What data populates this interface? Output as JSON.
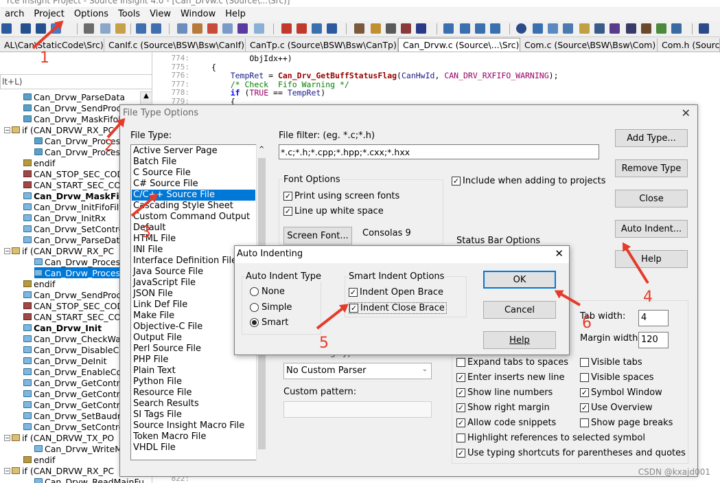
{
  "window": {
    "title": "rce Insight Project - Source Insight 4.0 - [Can_Drvw.c (Source\\...\\Src)]"
  },
  "menu": [
    "arch",
    "Project",
    "Options",
    "Tools",
    "View",
    "Window",
    "Help"
  ],
  "tabs": [
    "AL\\Can\\StaticCode\\Src)",
    "CanIf.c (Source\\BSW\\Bsw\\CanIf)",
    "CanTp.c (Source\\BSW\\Bsw\\CanTp)",
    "Can_Drvw.c (Source\\...\\Src)",
    "Com.c (Source\\BSW\\Bsw\\Com)",
    "Com.h (Source"
  ],
  "symbol_search": "lt+L)",
  "symbols": [
    {
      "label": "Can_Drvw_ParseData",
      "icon": "fn"
    },
    {
      "label": "Can_Drvw_SendProce",
      "icon": "fn"
    },
    {
      "label": "Can_Drvw_MaskFifoF",
      "icon": "fn"
    },
    {
      "label": "if (CAN_DRVW_RX_PC",
      "icon": "cond",
      "toggle": "-"
    },
    {
      "label": "Can_Drvw_Process",
      "icon": "fn",
      "indent": 1
    },
    {
      "label": "Can_Drvw_Process",
      "icon": "fn",
      "indent": 1
    },
    {
      "label": "endif",
      "icon": "endif"
    },
    {
      "label": "CAN_STOP_SEC_CODE",
      "icon": "macro"
    },
    {
      "label": "CAN_START_SEC_COD",
      "icon": "macro"
    },
    {
      "label": "Can_Drvw_MaskFifol",
      "icon": "fnlink",
      "bold": true
    },
    {
      "label": "Can_Drvw_InitFifoFilt",
      "icon": "fnlink"
    },
    {
      "label": "Can_Drvw_InitRx",
      "icon": "fnlink"
    },
    {
      "label": "Can_Drvw_SetContro",
      "icon": "fnlink"
    },
    {
      "label": "Can_Drvw_ParseData",
      "icon": "fnlink"
    },
    {
      "label": "if (CAN_DRVW_RX_PC",
      "icon": "cond",
      "toggle": "-"
    },
    {
      "label": "Can_Drvw_Process",
      "icon": "fnlink",
      "indent": 1
    },
    {
      "label": "Can_Drvw_Process",
      "icon": "fnlink",
      "indent": 1,
      "selected": true
    },
    {
      "label": "endif",
      "icon": "endif"
    },
    {
      "label": "Can_Drvw_SendProce",
      "icon": "fnlink"
    },
    {
      "label": "CAN_STOP_SEC_CODE",
      "icon": "macro"
    },
    {
      "label": "CAN_START_SEC_COD",
      "icon": "macro"
    },
    {
      "label": "Can_Drvw_Init",
      "icon": "fnlink",
      "bold": true
    },
    {
      "label": "Can_Drvw_CheckWak",
      "icon": "fnlink"
    },
    {
      "label": "Can_Drvw_DisableCo",
      "icon": "fnlink"
    },
    {
      "label": "Can_Drvw_DeInit",
      "icon": "fnlink"
    },
    {
      "label": "Can_Drvw_EnableCon",
      "icon": "fnlink"
    },
    {
      "label": "Can_Drvw_GetContro",
      "icon": "fnlink"
    },
    {
      "label": "Can_Drvw_GetContro",
      "icon": "fnlink"
    },
    {
      "label": "Can_Drvw_GetContro",
      "icon": "fnlink"
    },
    {
      "label": "Can_Drvw_SetBaudrat",
      "icon": "fnlink"
    },
    {
      "label": "Can_Drvw_SetContro",
      "icon": "fnlink"
    },
    {
      "label": "if (CAN_DRVW_TX_PO",
      "icon": "cond",
      "toggle": "-"
    },
    {
      "label": "Can_Drvw_WriteMa",
      "icon": "fnlink",
      "indent": 1
    },
    {
      "label": "endif",
      "icon": "endif"
    },
    {
      "label": "if (CAN_DRVW_RX_PC",
      "icon": "cond",
      "toggle": "-"
    },
    {
      "label": "Can_Drvw_ReadMainFu",
      "icon": "fnlink",
      "indent": 1
    }
  ],
  "code": [
    {
      "num": "774:",
      "text": "        ObjIdx++)"
    },
    {
      "num": "775:",
      "text": "{"
    },
    {
      "num": "776:",
      "text": "    TempRet = Can_Drv_GetBuffStatusFlag(CanHwId, CAN_DRV_RXFIFO_WARNING);"
    },
    {
      "num": "777:",
      "text": "    /* Check  Fifo Warning */"
    },
    {
      "num": "778:",
      "text": "    if (TRUE == TempRet)"
    },
    {
      "num": "779:",
      "text": "    {"
    }
  ],
  "code_tail": {
    "num": "822:",
    "text": ""
  },
  "file_type_dialog": {
    "title": "File Type Options",
    "file_type_label": "File Type:",
    "file_types": [
      "Active Server Page",
      "Batch File",
      "C Source File",
      "C# Source File",
      "C/C++ Source File",
      "Cascading Style Sheet",
      "Custom Command Output",
      "Default",
      "HTML File",
      "INI File",
      "Interface Definition File",
      "Java Source File",
      "JavaScript File",
      "JSON File",
      "Link Def File",
      "Make File",
      "Objective-C File",
      "Output File",
      "Perl Source File",
      "PHP File",
      "Plain Text",
      "Python File",
      "Resource File",
      "Search Results",
      "SI Tags File",
      "Source Insight Macro File",
      "Token Macro File",
      "VHDL File"
    ],
    "selected_file_type": "C/C++ Source File",
    "file_filter_label": "File filter: (eg. *.c;*.h)",
    "file_filter_value": "*.c;*.h;*.cpp;*.hpp;*.cxx;*.hxx",
    "include_when_adding": "Include when adding to projects",
    "font_options": {
      "title": "Font Options",
      "print_screen_fonts": "Print using screen fonts",
      "line_up_whitespace": "Line up white space",
      "screen_font_button": "Screen Font...",
      "font_name": "Consolas 9"
    },
    "status_bar_options": "Status Bar Options",
    "buttons": {
      "add_type": "Add Type...",
      "remove_type": "Remove Type",
      "close": "Close",
      "auto_indent": "Auto Indent...",
      "help": "Help"
    },
    "tab_width_label": "Tab width:",
    "tab_width_value": "4",
    "margin_width_label": "Margin width:",
    "margin_width_value": "120",
    "custom_tag_type_label": "Custom Tag Type:",
    "custom_parser_value": "No Custom Parser",
    "custom_pattern_label": "Custom pattern:",
    "options_left": [
      {
        "label": "Expand tabs to spaces",
        "checked": false
      },
      {
        "label": "Enter inserts new line",
        "checked": true
      },
      {
        "label": "Show line numbers",
        "checked": true
      },
      {
        "label": "Show right margin",
        "checked": true
      },
      {
        "label": "Allow code snippets",
        "checked": true
      }
    ],
    "options_right": [
      {
        "label": "Visible tabs",
        "checked": false
      },
      {
        "label": "Visible spaces",
        "checked": false
      },
      {
        "label": "Symbol Window",
        "checked": true
      },
      {
        "label": "Use Overview",
        "checked": true
      },
      {
        "label": "Show page breaks",
        "checked": false
      }
    ],
    "highlight_refs": {
      "label": "Highlight references to selected symbol",
      "checked": false
    },
    "typing_shortcuts": {
      "label": "Use typing shortcuts for parentheses and quotes",
      "checked": true
    }
  },
  "auto_indent_dialog": {
    "title": "Auto Indenting",
    "type_group": "Auto Indent Type",
    "none": "None",
    "simple": "Simple",
    "smart": "Smart",
    "smart_group": "Smart Indent Options",
    "indent_open": "Indent Open Brace",
    "indent_close": "Indent Close Brace",
    "ok": "OK",
    "cancel": "Cancel",
    "help": "Help"
  },
  "annotations": [
    "1",
    "2",
    "3",
    "4",
    "5",
    "6"
  ],
  "watermark": "CSDN @kxajd001",
  "colors": {
    "annotation": "#e53b2a",
    "selection": "#0078d7",
    "keyword": "#0000ff",
    "function": "#990000",
    "comment": "#008000",
    "macro": "#990066"
  }
}
